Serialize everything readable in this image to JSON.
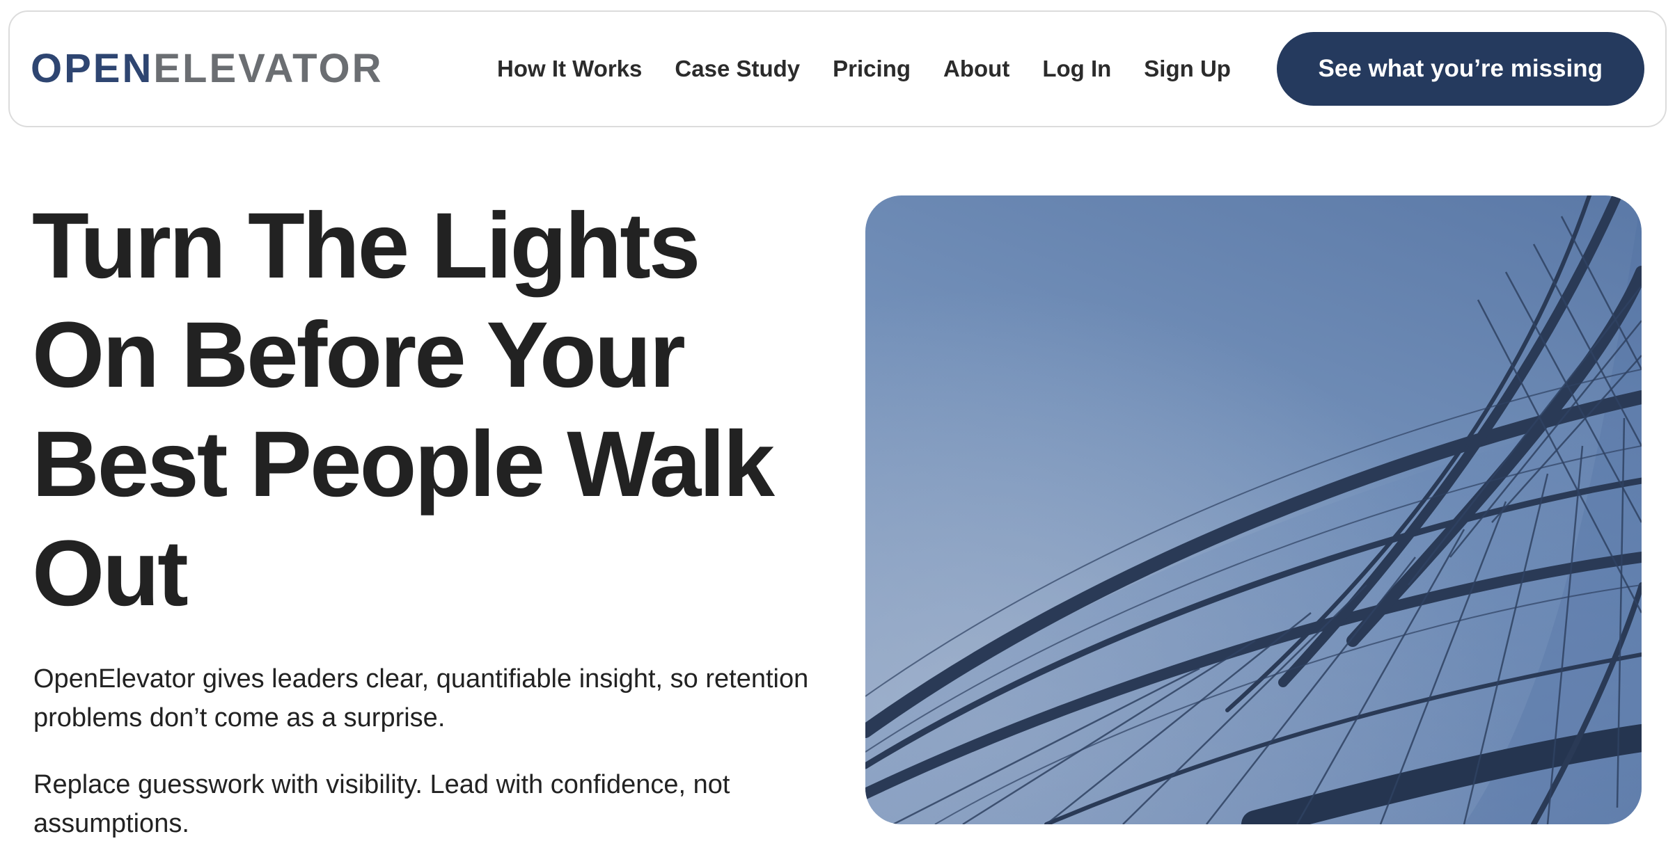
{
  "header": {
    "logo": {
      "part1": "OPEN",
      "part2": "ELEVATOR"
    },
    "nav": [
      {
        "label": "How It Works"
      },
      {
        "label": "Case Study"
      },
      {
        "label": "Pricing"
      },
      {
        "label": "About"
      },
      {
        "label": "Log In"
      },
      {
        "label": "Sign Up"
      }
    ],
    "cta_label": "See what you’re missing"
  },
  "hero": {
    "title": "Turn The Lights On Before Your Best People Walk Out",
    "paragraph1": "OpenElevator gives leaders clear, quantifiable insight, so retention problems don’t come as a surprise.",
    "paragraph2": "Replace guesswork with visibility. Lead with confidence, not assumptions."
  },
  "colors": {
    "brand_navy": "#253a5e",
    "logo_open": "#2e4571",
    "logo_elevator": "#6b6e72",
    "text": "#222222"
  }
}
